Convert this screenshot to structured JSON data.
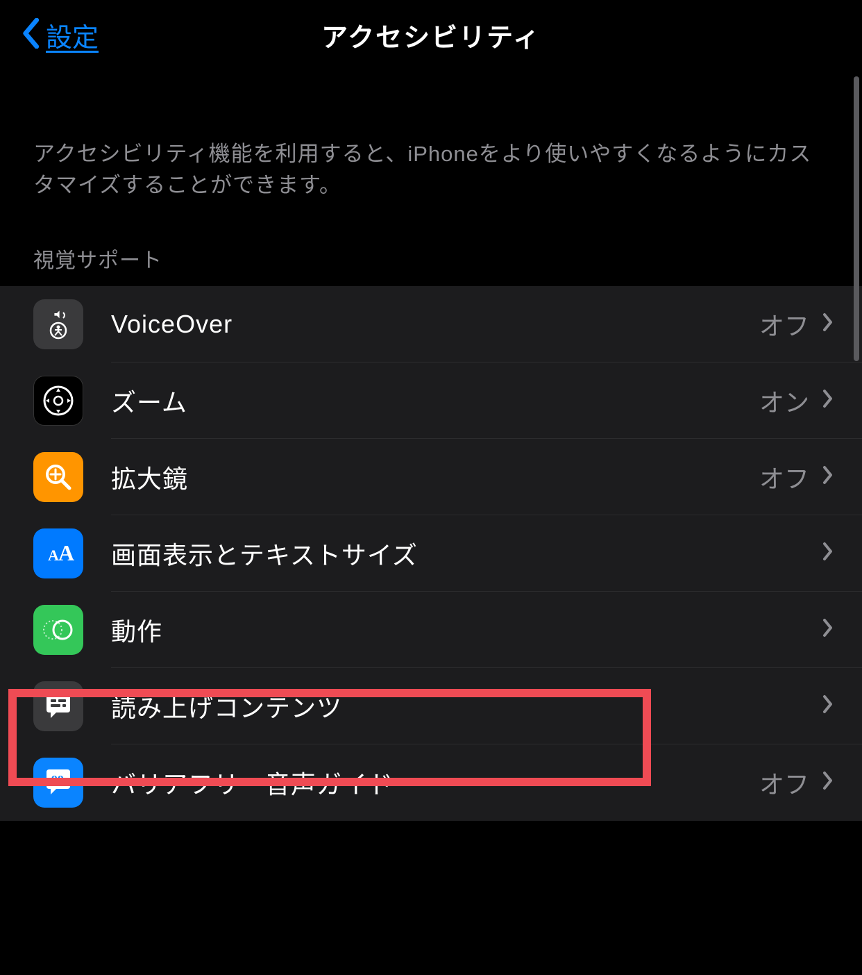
{
  "nav": {
    "back_label": "設定",
    "title": "アクセシビリティ"
  },
  "description": "アクセシビリティ機能を利用すると、iPhoneをより使いやすくなるようにカスタマイズすることができます。",
  "section_header": "視覚サポート",
  "rows": [
    {
      "label": "VoiceOver",
      "value": "オフ"
    },
    {
      "label": "ズーム",
      "value": "オン"
    },
    {
      "label": "拡大鏡",
      "value": "オフ"
    },
    {
      "label": "画面表示とテキストサイズ",
      "value": ""
    },
    {
      "label": "動作",
      "value": ""
    },
    {
      "label": "読み上げコンテンツ",
      "value": ""
    },
    {
      "label": "バリアフリー音声ガイド",
      "value": "オフ"
    }
  ]
}
